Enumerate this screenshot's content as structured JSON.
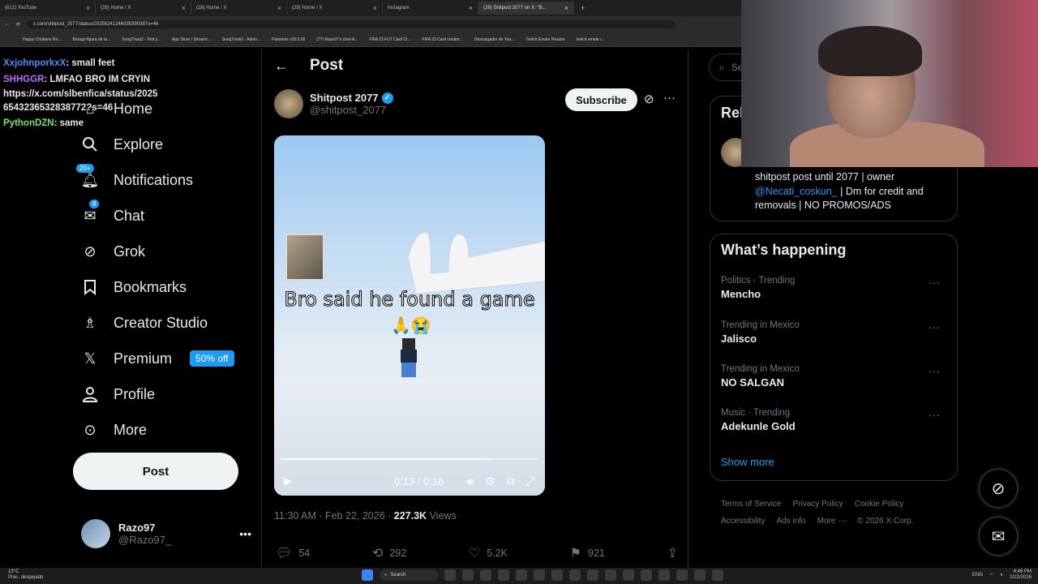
{
  "browser": {
    "tabs": [
      {
        "label": "(612) YouTube",
        "active": false
      },
      {
        "label": "(28) Home / X",
        "active": false
      },
      {
        "label": "(28) Home / X",
        "active": false
      },
      {
        "label": "(29) Home / X",
        "active": false
      },
      {
        "label": "Instagram",
        "active": false
      },
      {
        "label": "(29) Shitpost 2077 on X: \"B...",
        "active": true
      }
    ],
    "url": "x.com/shitpost_2077/status/2025624124603539038​7s=46",
    "bookmarks": [
      "Happy Cristiano Ro...",
      "Burago figura de ta...",
      "SongTrivia2 - Test y...",
      "App Store / Streami...",
      "SongTrivia2 - Advin...",
      "Paletools v26.0.28",
      "(77) Razo97's Zest-A...",
      "FIFA 23 FUT Card Cr...",
      "FIFA 23 Card creator...",
      "Descargador de You...",
      "Twitch Emote Resizer",
      "twitch emote r..."
    ]
  },
  "chat": [
    {
      "user": "XxjohnporkxX",
      "msg": ": small feet",
      "color": "nm1"
    },
    {
      "user": "SHHGGR",
      "msg": ": LMFAO BRO IM CRYIN",
      "color": "nm2"
    },
    {
      "user": "",
      "msg": "https://x.com/slbenfica/status/2025 6543236532838772?s=46",
      "color": ""
    },
    {
      "user": "PythonDZN",
      "msg": ": same",
      "color": "nm3"
    }
  ],
  "nav": {
    "home": "Home",
    "explore": "Explore",
    "notifications": "Notifications",
    "notifications_badge": "20+",
    "chat": "Chat",
    "chat_badge": "8",
    "grok": "Grok",
    "bookmarks": "Bookmarks",
    "creator_studio": "Creator Studio",
    "premium": "Premium",
    "premium_pill": "50% off",
    "profile": "Profile",
    "more": "More",
    "post_button": "Post"
  },
  "account": {
    "name": "Razo97",
    "handle": "@Razo97_"
  },
  "post": {
    "header": "Post",
    "author_name": "Shitpost 2077",
    "author_handle": "@shitpost_2077",
    "subscribe": "Subscribe",
    "video_caption": "Bro said he found a game",
    "video_emoji": "🙏😭",
    "video_time": "0:13 / 0:16",
    "progress_fraction": 0.8125,
    "timestamp": "11:30 AM · Feb 22, 2026 · ",
    "views_count": "227.3K",
    "views_label": " Views",
    "replies": "54",
    "reposts": "292",
    "likes": "5.2K",
    "bookmarks": "921"
  },
  "sidebar": {
    "search_placeholder": "Se",
    "relevant_title": "Rel",
    "bio_before": "shitpost post until 2077 | owner ",
    "bio_link": "@Necati_coskun_",
    "bio_after": " | Dm for credit and removals | NO PROMOS/ADS",
    "happening_title": "What’s happening",
    "trends": [
      {
        "category": "Politics · Trending",
        "name": "Mencho"
      },
      {
        "category": "Trending in Mexico",
        "name": "Jalisco"
      },
      {
        "category": "Trending in Mexico",
        "name": "NO SALGAN"
      },
      {
        "category": "Music · Trending",
        "name": "Adekunle Gold"
      }
    ],
    "show_more": "Show more",
    "footer": [
      "Terms of Service",
      "Privacy Policy",
      "Cookie Policy",
      "Accessibility",
      "Ads info",
      "More ···",
      "© 2026 X Corp."
    ]
  },
  "taskbar": {
    "temp": "13°C",
    "weather": "Prac. despejado",
    "search": "Search",
    "lang": "ENG",
    "time": "4:46 PM",
    "date": "2/22/2026"
  },
  "colors": {
    "accent": "#1d9bf0",
    "background": "#000000",
    "text": "#e7e9ea",
    "muted": "#71767b"
  }
}
